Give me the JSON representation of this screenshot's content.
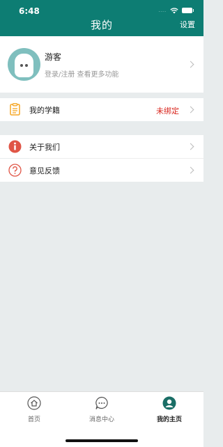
{
  "status": {
    "time": "6:48",
    "signal": "...."
  },
  "header": {
    "title": "我的",
    "settings_label": "设置"
  },
  "profile": {
    "name": "游客",
    "subtitle": "登录/注册 查看更多功能"
  },
  "menu": {
    "student_status": {
      "label": "我的学籍",
      "value": "未绑定"
    },
    "about": {
      "label": "关于我们"
    },
    "feedback": {
      "label": "意见反馈"
    }
  },
  "tabs": [
    {
      "label": "首页",
      "icon": "home-icon"
    },
    {
      "label": "消息中心",
      "icon": "message-icon"
    },
    {
      "label": "我的主页",
      "icon": "profile-icon"
    }
  ],
  "colors": {
    "header": "#0d7d73",
    "accent_red": "#d9251d",
    "about_icon": "#e05546",
    "list_icon_orange": "#f5a623"
  }
}
